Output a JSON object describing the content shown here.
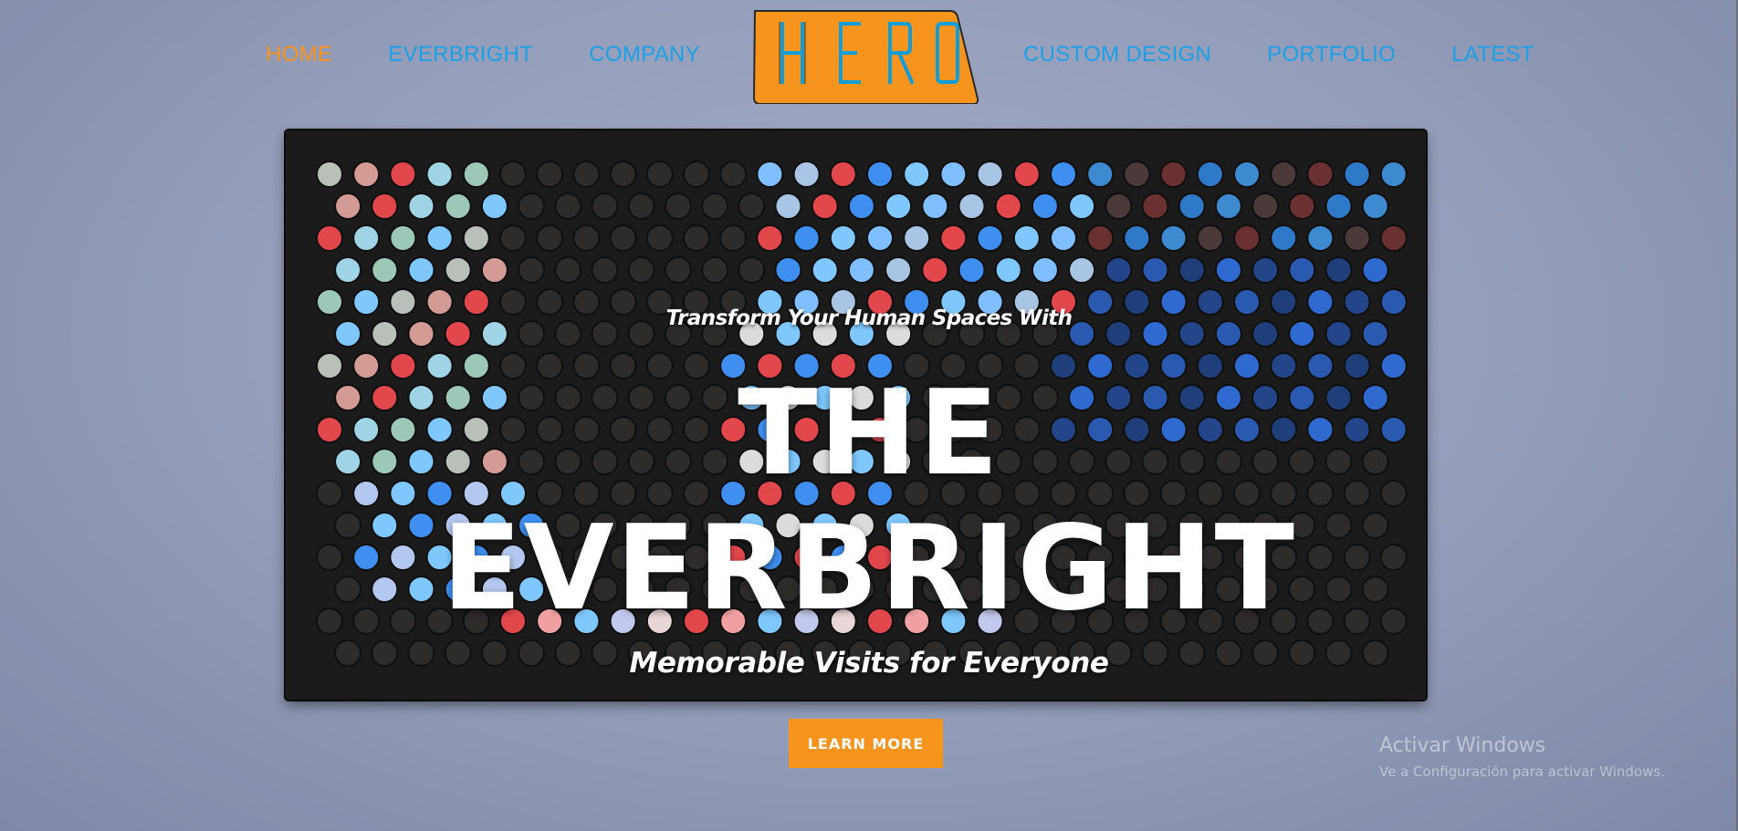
{
  "nav": {
    "left": [
      {
        "label": "HOME",
        "active": true
      },
      {
        "label": "EVERBRIGHT",
        "active": false
      },
      {
        "label": "COMPANY",
        "active": false
      }
    ],
    "right": [
      {
        "label": "CUSTOM DESIGN",
        "active": false
      },
      {
        "label": "PORTFOLIO",
        "active": false
      },
      {
        "label": "LATEST",
        "active": false
      }
    ],
    "logo_text": "HERO"
  },
  "hero": {
    "tagline": "Transform Your Human Spaces With",
    "title_line1": "THE",
    "title_line2": "EVERBRIGHT",
    "subtitle": "Memorable Visits for Everyone",
    "cta_label": "LEARN MORE"
  },
  "watermark": {
    "line1": "Activar Windows",
    "line2": "Ve a Configuración para activar Windows."
  },
  "colors": {
    "accent": "#f7941d",
    "nav_link": "#1aa0e8",
    "led_off": "#2e2b2b",
    "led_red": "#e2474c",
    "led_blue": "#3f8ff0",
    "led_light_blue": "#7ec8ff"
  },
  "icons": {
    "logo": "hero-logo-icon"
  }
}
